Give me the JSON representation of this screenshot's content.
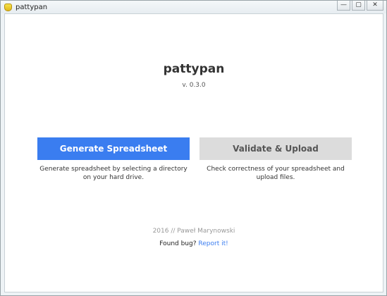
{
  "window": {
    "title": "pattypan",
    "controls": {
      "minimize": "—",
      "maximize": "▢",
      "close": "✕"
    }
  },
  "app": {
    "name": "pattypan",
    "version": "v. 0.3.0"
  },
  "actions": {
    "generate": {
      "label": "Generate Spreadsheet",
      "description": "Generate spreadsheet by selecting a directory on your hard drive."
    },
    "validate": {
      "label": "Validate & Upload",
      "description": "Check correctness of your spreadsheet and upload files."
    }
  },
  "footer": {
    "credit": "2016 // Paweł Marynowski",
    "bug_text": "Found bug?",
    "report_link": "Report it!"
  },
  "colors": {
    "primary_button": "#3a7df0",
    "secondary_button": "#dcdcdc",
    "link": "#3a7df0"
  }
}
